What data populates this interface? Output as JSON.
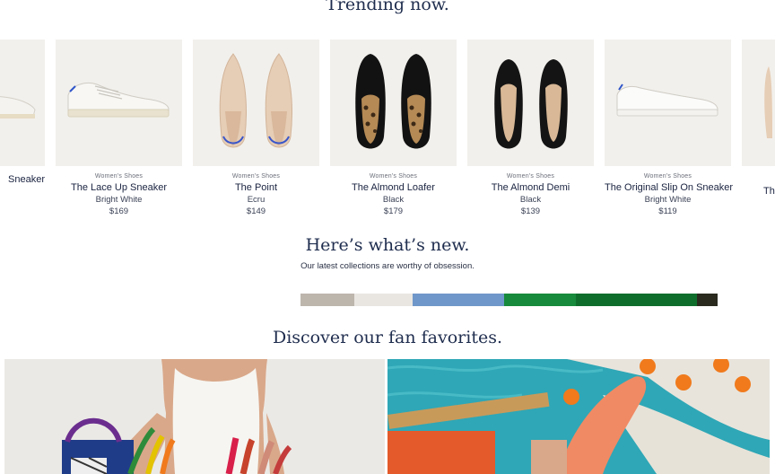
{
  "trending": {
    "title": "Trending now.",
    "products": [
      {
        "category": "",
        "name": "Sneaker",
        "color": "",
        "price": ""
      },
      {
        "category": "Women's Shoes",
        "name": "The Lace Up Sneaker",
        "color": "Bright White",
        "price": "$169"
      },
      {
        "category": "Women's Shoes",
        "name": "The Point",
        "color": "Ecru",
        "price": "$149"
      },
      {
        "category": "Women's Shoes",
        "name": "The Almond Loafer",
        "color": "Black",
        "price": "$179"
      },
      {
        "category": "Women's Shoes",
        "name": "The Almond Demi",
        "color": "Black",
        "price": "$139"
      },
      {
        "category": "Women's Shoes",
        "name": "The Original Slip On Sneaker",
        "color": "Bright White",
        "price": "$119"
      },
      {
        "category": "",
        "name": "Th",
        "color": "",
        "price": ""
      }
    ]
  },
  "new_section": {
    "title": "Here’s what’s new.",
    "subtitle": "Our latest collections are worthy of obsession."
  },
  "favorites": {
    "title": "Discover our fan favorites."
  },
  "colors": {
    "heading": "#1f2d4e",
    "card_bg": "#f2f0ec",
    "strip": [
      "#bdb6ad",
      "#e9e6e1",
      "#6f97c9",
      "#178a3b",
      "#0f6d2c",
      "#2a2a1f"
    ]
  }
}
